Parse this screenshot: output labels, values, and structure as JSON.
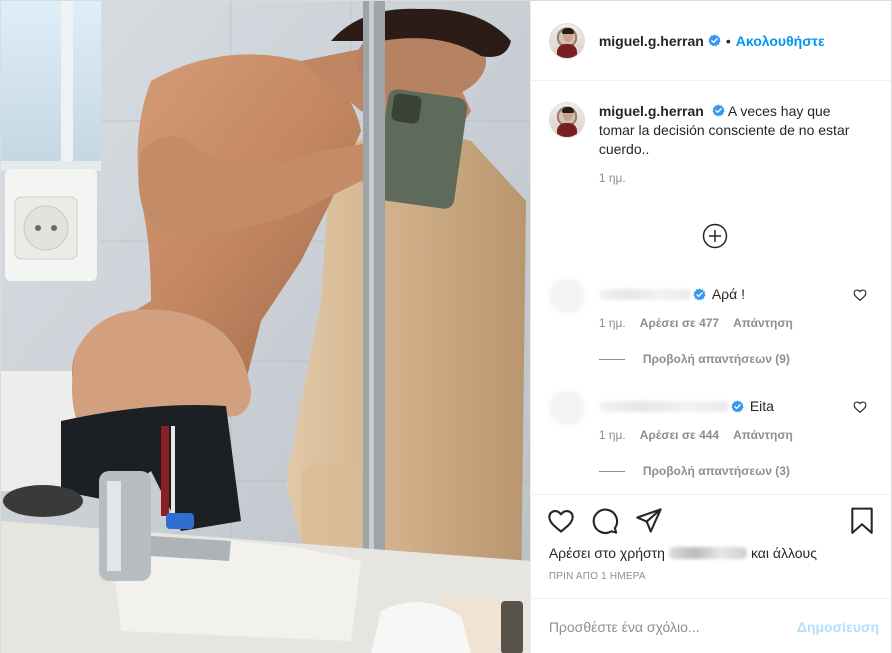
{
  "colors": {
    "accent": "#0095f6",
    "verified": "#3897f0",
    "muted": "#8e8e8e",
    "post_disabled": "#b2dffc"
  },
  "header": {
    "username": "miguel.g.herran",
    "separator": "•",
    "follow_label": "Ακολουθήστε"
  },
  "caption": {
    "username": "miguel.g.herran",
    "text": "A veces hay que tomar la decisión consciente de no estar cuerdo..",
    "time": "1 ημ."
  },
  "load_more_icon": "plus-circle-icon",
  "comments": [
    {
      "text": "Αρά !",
      "time": "1 ημ.",
      "likes": "Αρέσει σε 477",
      "reply_label": "Απάντηση",
      "view_replies": "Προβολή απαντήσεων (9)"
    },
    {
      "text": "Eita",
      "time": "1 ημ.",
      "likes": "Αρέσει σε 444",
      "reply_label": "Απάντηση",
      "view_replies": "Προβολή απαντήσεων (3)"
    }
  ],
  "actions": {
    "icons": [
      "heart-icon",
      "comment-icon",
      "share-icon",
      "bookmark-icon"
    ],
    "likes_prefix": "Αρέσει στο χρήστη",
    "likes_suffix": "και άλλους",
    "posted_ago": "ΠΡΙΝ ΑΠΟ 1 ΗΜΕΡΑ"
  },
  "add_comment": {
    "placeholder": "Προσθέστε ένα σχόλιο...",
    "post_label": "Δημοσίευση"
  }
}
